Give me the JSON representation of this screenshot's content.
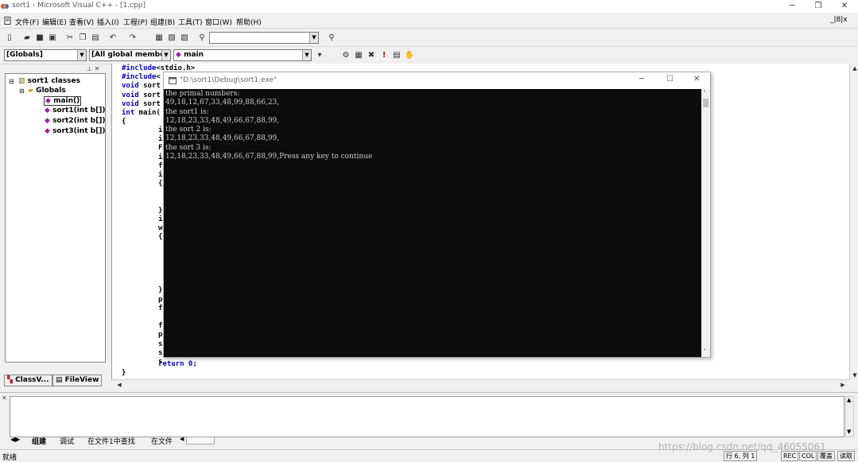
{
  "window": {
    "title": "sort1 - Microsoft Visual C++ - [1.cpp]",
    "minimize": "─",
    "restore": "❐",
    "close": "✕"
  },
  "menubar": {
    "items": [
      "文件(F)",
      "编辑(E)",
      "查看(V)",
      "插入(I)",
      "工程(P)",
      "组建(B)",
      "工具(T)",
      "窗口(W)",
      "帮助(H)"
    ],
    "mdi_controls": "_|8|x"
  },
  "toolbar2": {
    "globals": "[Globals]",
    "members": "[All global members",
    "function": "main"
  },
  "workspace": {
    "tree": [
      {
        "label": "sort1 classes",
        "icon": "class-icon"
      },
      {
        "label": "Globals",
        "icon": "folder-icon"
      },
      {
        "label": "main()",
        "icon": "function-icon"
      },
      {
        "label": "sort1(int b[])",
        "icon": "function-icon"
      },
      {
        "label": "sort2(int b[])",
        "icon": "function-icon"
      },
      {
        "label": "sort3(int b[])",
        "icon": "function-icon"
      }
    ],
    "tabs": [
      "ClassV...",
      "FileView"
    ]
  },
  "editor": {
    "lines": [
      {
        "k": "#include",
        "t": "<stdio.h>"
      },
      {
        "k": "#include",
        "t": "<"
      },
      {
        "k": "void",
        "t": " sort"
      },
      {
        "k": "void",
        "t": " sort"
      },
      {
        "k": "void",
        "t": " sort"
      },
      {
        "k": "int",
        "t": " main("
      },
      {
        "k": "",
        "t": "{"
      }
    ],
    "inner_lines": [
      "i",
      "i",
      "F",
      "i",
      "f",
      "i",
      "{",
      "",
      "",
      "}",
      "i",
      "w",
      "{",
      "",
      "",
      "",
      "",
      "",
      "}",
      "p",
      "f",
      "",
      "f",
      "p",
      "s",
      "s",
      "s"
    ],
    "return_line": "return 0;",
    "close_brace": "}"
  },
  "console": {
    "title": "\"D:\\sort1\\Debug\\sort1.exe\"",
    "lines": [
      "the primal numbers:",
      "49,18,12,67,33,48,99,88,66,23,",
      "the sort1 is:",
      "12,18,23,33,48,49,66,67,88,99,",
      "the sort 2 is:",
      "12,18,23,33,48,49,66,67,88,99,",
      "the sort 3 is:",
      "12,18,23,33,48,49,66,67,88,99,Press any key to continue"
    ]
  },
  "output": {
    "tabs": [
      "组建",
      "调试",
      "在文件1中查找",
      "在文件"
    ]
  },
  "statusbar": {
    "ready": "就绪",
    "position": "行 6, 列 1",
    "indicators": [
      "REC",
      "COL",
      "覆盖",
      "读取"
    ]
  },
  "watermark": "https://blog.csdn.net/qq_46055061"
}
